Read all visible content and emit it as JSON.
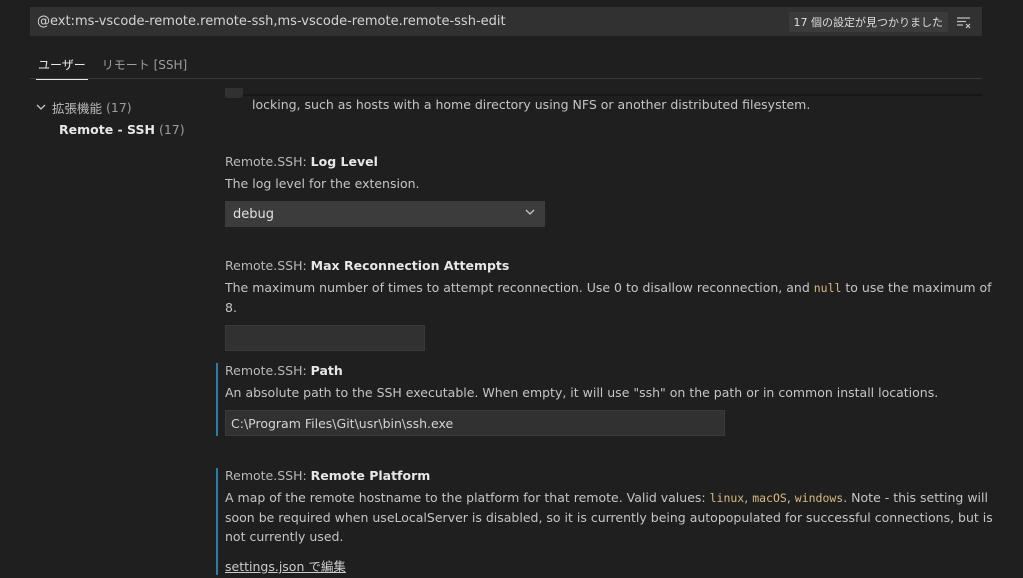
{
  "search": {
    "query": "@ext:ms-vscode-remote.remote-ssh,ms-vscode-remote.remote-ssh-edit",
    "result_count": "17 個の設定が見つかりました",
    "filter_icon": "clear-filter-icon"
  },
  "tabs": [
    {
      "label": "ユーザー",
      "active": true
    },
    {
      "label": "リモート [SSH]",
      "active": false
    }
  ],
  "toc": {
    "group": {
      "label": "拡張機能",
      "count": "(17)"
    },
    "child": {
      "label": "Remote - SSH",
      "count": "(17)"
    }
  },
  "cutoff_text": "locking, such as hosts with a home directory using NFS or another distributed filesystem.",
  "settings": {
    "log_level": {
      "category": "Remote.SSH: ",
      "name": "Log Level",
      "description": "The log level for the extension.",
      "value": "debug"
    },
    "max_reconnect": {
      "category": "Remote.SSH: ",
      "name": "Max Reconnection Attempts",
      "desc_before": "The maximum number of times to attempt reconnection. Use 0 to disallow reconnection, and ",
      "desc_code": "null",
      "desc_after": " to use the maximum of 8.",
      "value": ""
    },
    "path": {
      "category": "Remote.SSH: ",
      "name": "Path",
      "description": "An absolute path to the SSH executable. When empty, it will use \"ssh\" on the path or in common install locations.",
      "value": "C:\\Program Files\\Git\\usr\\bin\\ssh.exe"
    },
    "remote_platform": {
      "category": "Remote.SSH: ",
      "name": "Remote Platform",
      "desc_1": "A map of the remote hostname to the platform for that remote. Valid values: ",
      "code_1": "linux",
      "sep_1": ", ",
      "code_2": "macOS",
      "sep_2": ", ",
      "code_3": "windows",
      "desc_2": ". Note - this setting will soon be required when useLocalServer is disabled, so it is currently being autopopulated for successful connections, but is not currently used.",
      "link": "settings.json で編集"
    }
  },
  "colors": {
    "background": "#1f1f1f",
    "modified_indicator": "#2e7ca8",
    "code_text": "#d7ba7d"
  }
}
